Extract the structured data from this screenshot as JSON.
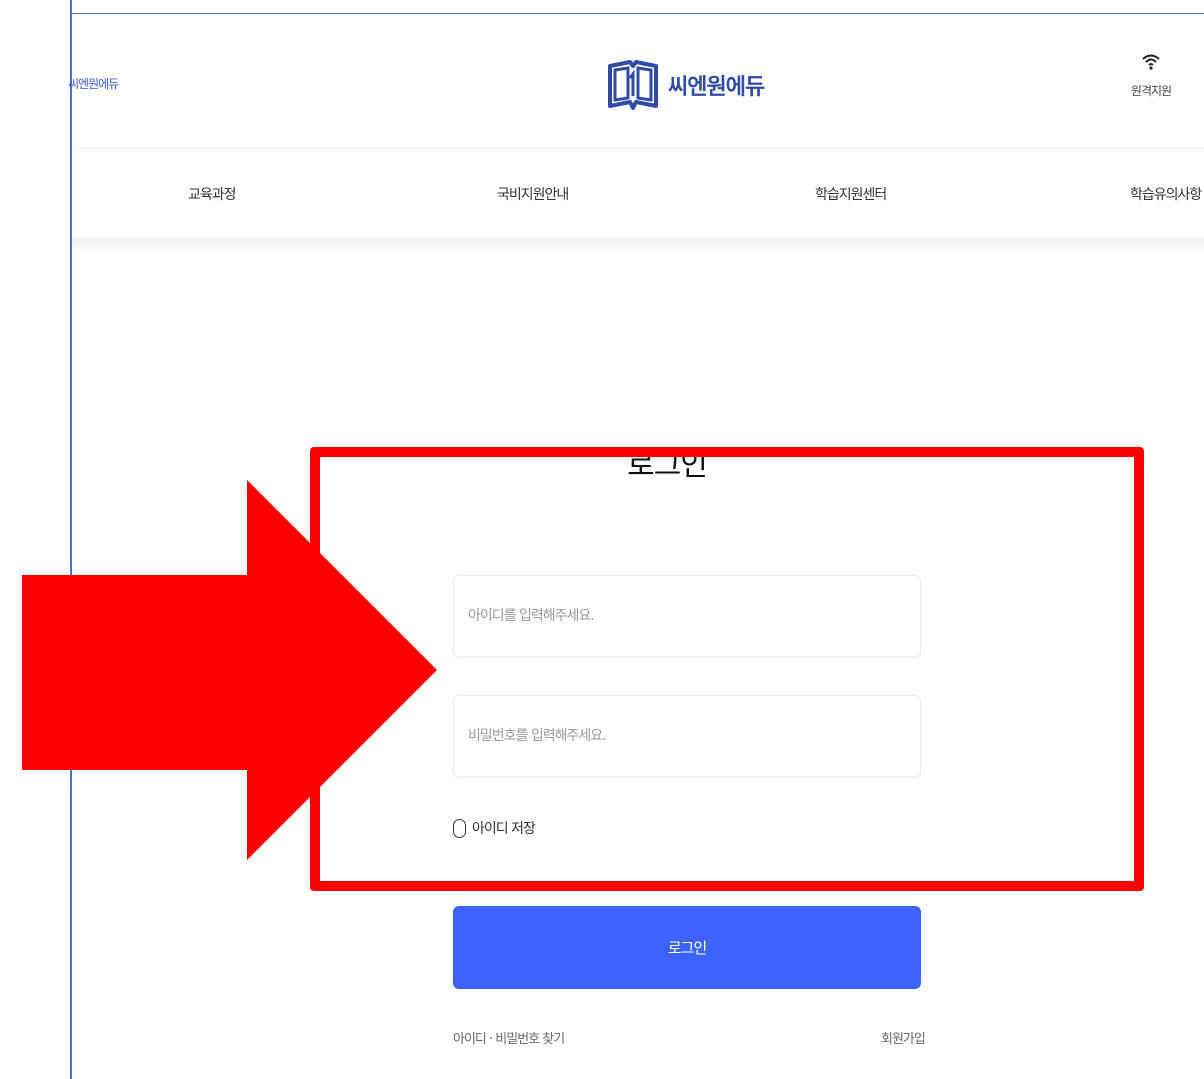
{
  "header": {
    "small_brand": "씨엔원에듀",
    "logo_text": "씨엔원에듀",
    "remote_support_label": "원격지원"
  },
  "nav": {
    "items": [
      {
        "label": "교육과정"
      },
      {
        "label": "국비지원안내"
      },
      {
        "label": "학습지원센터"
      },
      {
        "label": "학습유의사항"
      }
    ]
  },
  "login": {
    "title": "로그인",
    "id_placeholder": "아이디를 입력해주세요.",
    "password_placeholder": "비밀번호를 입력해주세요.",
    "save_id_label": "아이디 저장",
    "submit_label": "로그인",
    "find_link": "아이디 · 비밀번호 찾기",
    "signup_link": "회원가입"
  },
  "colors": {
    "brand": "#2f4aa8",
    "button": "#3d63ff",
    "annotation": "#ff0000"
  },
  "icons": {
    "logo": "open-book-logo-icon",
    "remote": "wifi-icon"
  }
}
